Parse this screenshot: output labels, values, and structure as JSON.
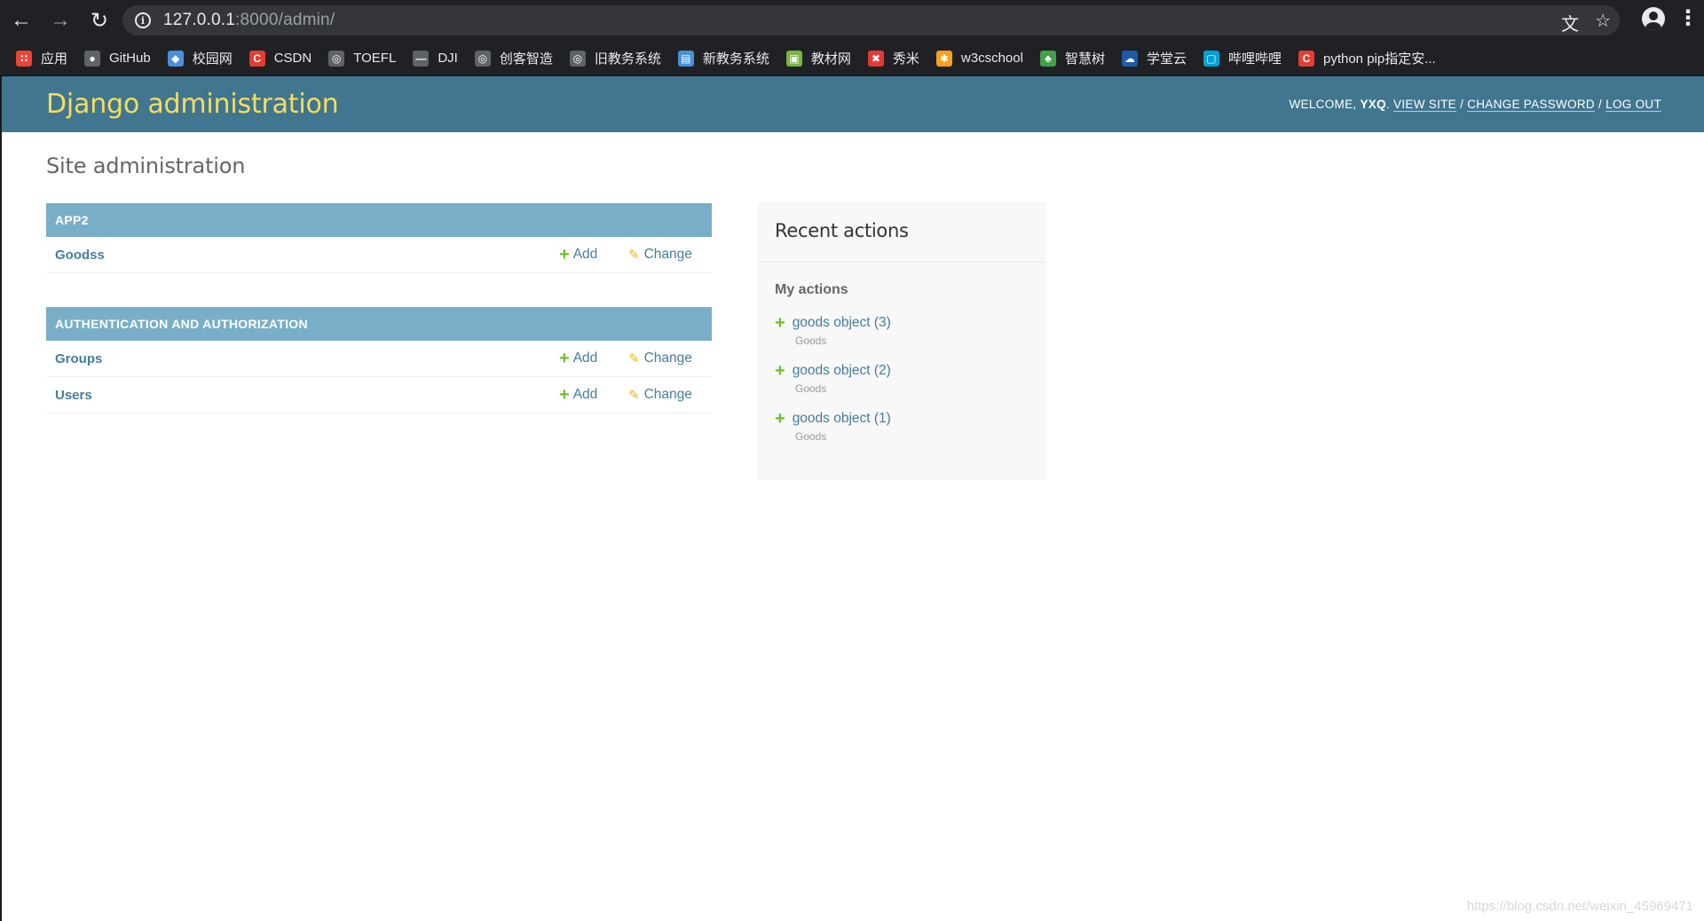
{
  "browser": {
    "url_host": "127.0.0.1",
    "url_rest": ":8000/admin/",
    "bookmarks": [
      {
        "label": "应用",
        "icon": "apps-icon",
        "color": "#ea4335"
      },
      {
        "label": "GitHub",
        "icon": "github-icon",
        "color": "#5f6368"
      },
      {
        "label": "校园网",
        "icon": "campus-icon",
        "color": "#4a90d9"
      },
      {
        "label": "CSDN",
        "icon": "csdn-icon",
        "color": "#e33e33"
      },
      {
        "label": "TOEFL",
        "icon": "globe-icon",
        "color": "#5f6368"
      },
      {
        "label": "DJI",
        "icon": "dji-icon",
        "color": "#5f6368"
      },
      {
        "label": "创客智造",
        "icon": "globe-icon",
        "color": "#5f6368"
      },
      {
        "label": "旧教务系统",
        "icon": "globe-icon",
        "color": "#5f6368"
      },
      {
        "label": "新教务系统",
        "icon": "page-icon",
        "color": "#4a90d9"
      },
      {
        "label": "教材网",
        "icon": "cube-icon",
        "color": "#7cb342"
      },
      {
        "label": "秀米",
        "icon": "xiumi-icon",
        "color": "#e53935"
      },
      {
        "label": "w3cschool",
        "icon": "w3c-icon",
        "color": "#f6a21e"
      },
      {
        "label": "智慧树",
        "icon": "tree-icon",
        "color": "#43a047"
      },
      {
        "label": "学堂云",
        "icon": "cloud-icon",
        "color": "#1e5aa8"
      },
      {
        "label": "哔哩哔哩",
        "icon": "bilibili-icon",
        "color": "#00a1d6"
      },
      {
        "label": "python pip指定安...",
        "icon": "csdn-icon",
        "color": "#e33e33"
      }
    ]
  },
  "admin": {
    "branding": "Django administration",
    "welcome": "WELCOME,",
    "username": "YXQ",
    "view_site": "VIEW SITE",
    "change_password": "CHANGE PASSWORD",
    "log_out": "LOG OUT",
    "sep": "/",
    "page_title": "Site administration",
    "modules": [
      {
        "caption": "APP2",
        "models": [
          {
            "name": "Goodss",
            "add": "Add",
            "change": "Change"
          }
        ]
      },
      {
        "caption": "AUTHENTICATION AND AUTHORIZATION",
        "models": [
          {
            "name": "Groups",
            "add": "Add",
            "change": "Change"
          },
          {
            "name": "Users",
            "add": "Add",
            "change": "Change"
          }
        ]
      }
    ],
    "recent": {
      "title": "Recent actions",
      "subtitle": "My actions",
      "items": [
        {
          "label": "goods object (3)",
          "type": "Goods"
        },
        {
          "label": "goods object (2)",
          "type": "Goods"
        },
        {
          "label": "goods object (1)",
          "type": "Goods"
        }
      ]
    }
  },
  "watermark": "https://blog.csdn.net/weixin_45969471"
}
